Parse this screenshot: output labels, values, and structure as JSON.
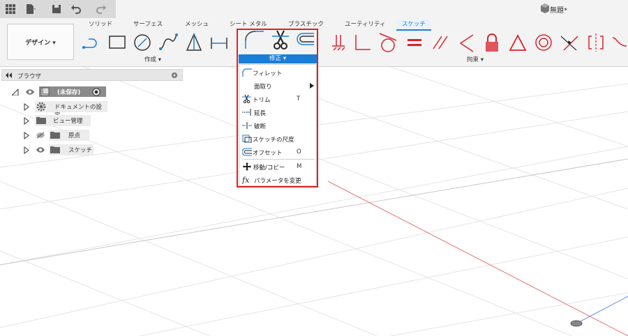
{
  "app": {
    "doc_title": "無題*"
  },
  "ribbon": {
    "tabs": [
      {
        "label": "ソリッド"
      },
      {
        "label": "サーフェス"
      },
      {
        "label": "メッシュ"
      },
      {
        "label": "シート メタル"
      },
      {
        "label": "プラスチック"
      },
      {
        "label": "ユーティリティ"
      },
      {
        "label": "スケッチ",
        "active": true
      }
    ],
    "workspace_button": "デザイン ▾",
    "groups": {
      "create": "作成 ▾",
      "modify": "修正 ▾",
      "constraints": "拘束 ▾"
    }
  },
  "browser": {
    "title": "ブラウザ",
    "root": "(未保存)",
    "items": [
      {
        "label": "ドキュメントの設定",
        "icon": "gear-icon"
      },
      {
        "label": "ビュー管理",
        "icon": "folder-icon"
      },
      {
        "label": "原点",
        "icon": "folder-icon"
      },
      {
        "label": "スケッチ",
        "icon": "folder-icon"
      }
    ]
  },
  "modify_menu": {
    "items": [
      {
        "label": "フィレット",
        "key": "",
        "icon": "fillet-icon"
      },
      {
        "label": "面取り",
        "key": "",
        "icon": "",
        "submenu": true
      },
      {
        "label": "トリム",
        "key": "T",
        "icon": "trim-icon"
      },
      {
        "label": "延長",
        "key": "",
        "icon": "extend-icon"
      },
      {
        "label": "破断",
        "key": "",
        "icon": "break-icon"
      },
      {
        "label": "スケッチの尺度",
        "key": "",
        "icon": "sketch-scale-icon"
      },
      {
        "label": "オフセット",
        "key": "O",
        "icon": "offset-icon"
      },
      {
        "label": "移動/コピー",
        "key": "M",
        "icon": "move-copy-icon"
      },
      {
        "label": "パラメータを変更",
        "key": "",
        "icon": "fx-icon"
      }
    ]
  },
  "colors": {
    "accent": "#1b7ed6",
    "highlight_border": "#e02020",
    "constraint_red": "#d9232e"
  }
}
